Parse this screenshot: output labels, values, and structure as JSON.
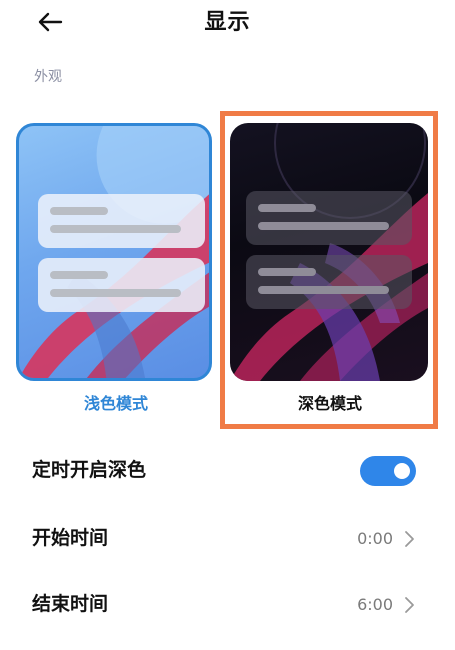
{
  "header": {
    "title": "显示",
    "back_icon": "arrow-left-icon"
  },
  "section": {
    "label": "外观"
  },
  "appearance": {
    "light_label": "浅色模式",
    "dark_label": "深色模式",
    "selected": "light",
    "highlighted": "dark"
  },
  "settings": {
    "schedule": {
      "label": "定时开启深色",
      "enabled": true
    },
    "start": {
      "label": "开始时间",
      "value": "0:00"
    },
    "end": {
      "label": "结束时间",
      "value": "6:00"
    }
  },
  "colors": {
    "accent": "#2f86d6",
    "toggle_on": "#2f86e9",
    "highlight_frame": "#f07b46",
    "secondary_text": "#8b8fa3"
  }
}
